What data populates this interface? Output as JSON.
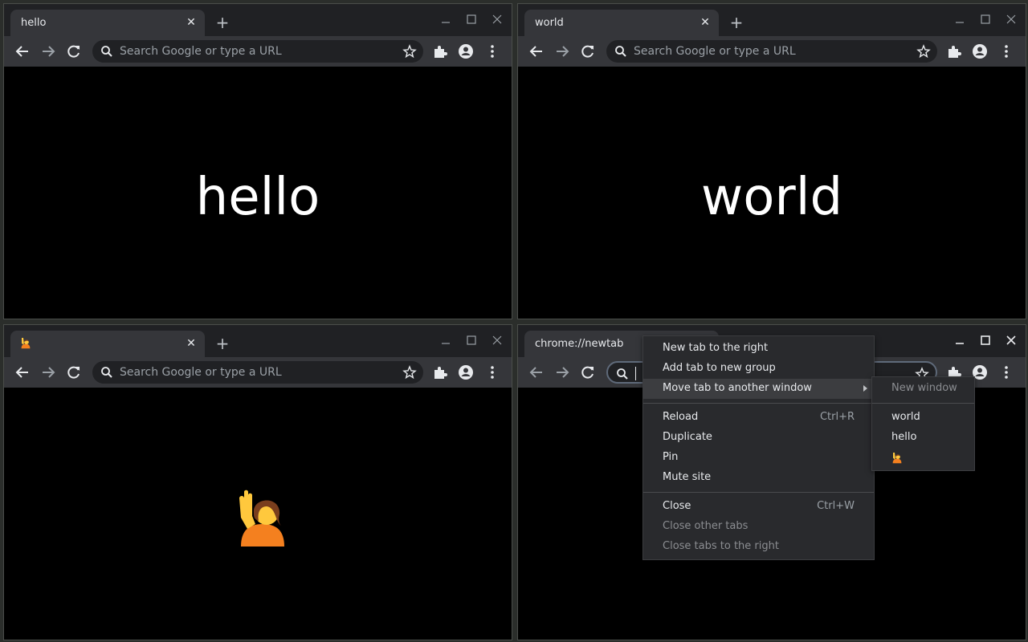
{
  "windows": [
    {
      "tab_title": "hello",
      "omnibox_placeholder": "Search Google or type a URL",
      "page_text": "hello"
    },
    {
      "tab_title": "world",
      "omnibox_placeholder": "Search Google or type a URL",
      "page_text": "world"
    },
    {
      "tab_icon": "raising-hand-emoji",
      "omnibox_placeholder": "Search Google or type a URL",
      "page_icon": "raising-hand-emoji"
    },
    {
      "tab_title": "chrome://newtab",
      "omnibox_placeholder": "Search Google or type a URL"
    }
  ],
  "icons": {
    "close": "close-icon",
    "new_tab": "plus-icon",
    "back": "arrow-left-icon",
    "forward": "arrow-right-icon",
    "reload": "reload-icon",
    "search": "search-icon",
    "star": "star-icon",
    "extensions": "puzzle-icon",
    "profile": "account-icon",
    "menu": "more-vert-icon"
  },
  "context_menu": {
    "items": [
      {
        "label": "New tab to the right"
      },
      {
        "label": "Add tab to new group"
      },
      {
        "label": "Move tab to another window",
        "has_submenu": true,
        "highlighted": true
      },
      {
        "label": "Reload",
        "shortcut": "Ctrl+R"
      },
      {
        "label": "Duplicate"
      },
      {
        "label": "Pin"
      },
      {
        "label": "Mute site"
      },
      {
        "label": "Close",
        "shortcut": "Ctrl+W"
      },
      {
        "label": "Close other tabs",
        "disabled": true
      },
      {
        "label": "Close tabs to the right",
        "disabled": true
      }
    ]
  },
  "submenu": {
    "items": [
      {
        "label": "New window",
        "disabled": true
      },
      {
        "label": "world"
      },
      {
        "label": "hello"
      },
      {
        "icon": "raising-hand-emoji"
      }
    ]
  },
  "colors": {
    "frame": "#202124",
    "toolbar": "#35363a",
    "content": "#000000",
    "menu_bg": "#292a2d",
    "menu_highlight": "#3c3d40"
  }
}
